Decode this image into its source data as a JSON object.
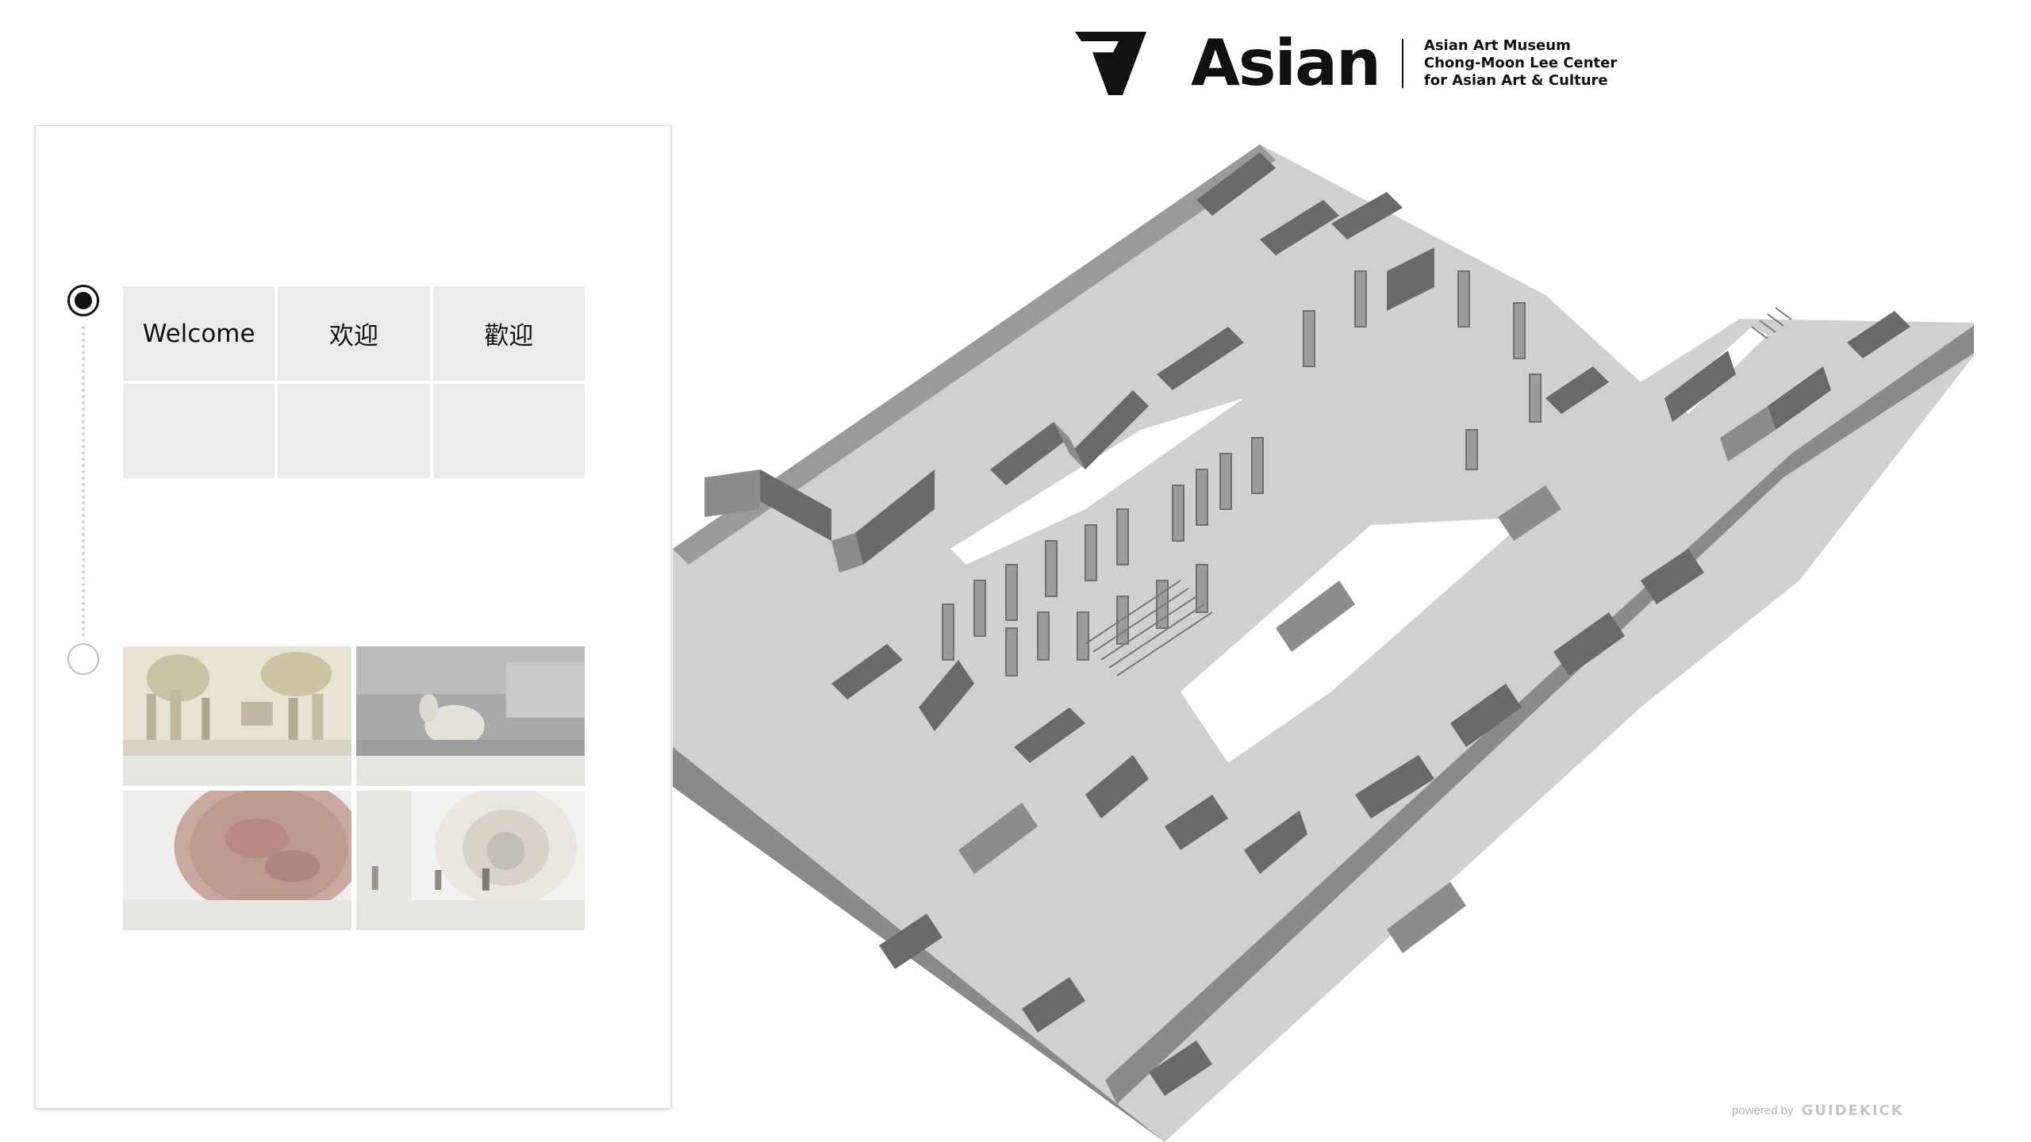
{
  "header": {
    "logo_wordmark": "Asian",
    "logo_lines": [
      "Asian Art Museum",
      "Chong-Moon Lee Center",
      "for Asian Art & Culture"
    ]
  },
  "sidebar": {
    "languages": [
      "Welcome",
      "欢迎",
      "歡迎",
      "",
      "",
      ""
    ],
    "gallery_images": [
      "procession-painting",
      "ceramic-vessel",
      "lacquer-plate",
      "gallery-installation"
    ]
  },
  "footer": {
    "powered_by": "powered by",
    "brand": "GUIDEKICK"
  },
  "colors": {
    "floor": "#d0d0d0",
    "wall_side": "#8a8a8a",
    "wall_dark": "#646464",
    "text": "#111111"
  }
}
